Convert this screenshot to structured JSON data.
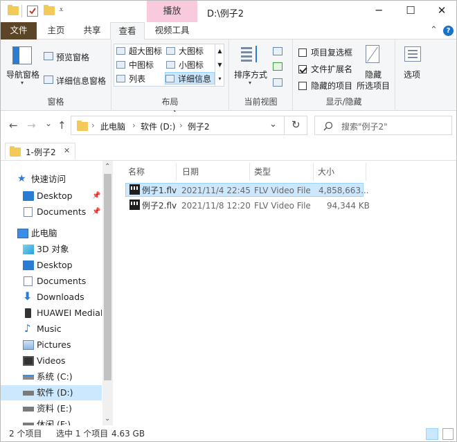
{
  "title": {
    "context_tab": "播放",
    "path": "D:\\例子2",
    "minimize": "─",
    "maximize": "☐",
    "close": "✕"
  },
  "ribbon_tabs": [
    {
      "label": "文件"
    },
    {
      "label": "主页"
    },
    {
      "label": "共享"
    },
    {
      "label": "查看"
    },
    {
      "label": "视频工具"
    }
  ],
  "ribbon": {
    "panes": {
      "nav_pane": "导航窗格",
      "preview_pane": "预览窗格",
      "details_pane": "详细信息窗格",
      "group_title": "窗格"
    },
    "layout": {
      "items": [
        "超大图标",
        "大图标",
        "中图标",
        "小图标",
        "列表",
        "详细信息"
      ],
      "group_title": "布局"
    },
    "current_view": {
      "sort": "排序方式",
      "group_title": "当前视图"
    },
    "show_hide": {
      "item_checkbox": "项目复选框",
      "extensions": "文件扩展名",
      "hidden_items": "隐藏的项目",
      "hide_selected_line1": "隐藏",
      "hide_selected_line2": "所选项目",
      "group_title": "显示/隐藏"
    },
    "options": "选项"
  },
  "address": {
    "back": "←",
    "forward": "→",
    "recent": "⌄",
    "up": "↑",
    "crumbs": [
      "此电脑",
      "软件 (D:)",
      "例子2"
    ],
    "sep": "›",
    "dropdown": "⌄",
    "refresh": "↻",
    "search_placeholder": "搜索\"例子2\""
  },
  "doc_tab": {
    "label": "1-例子2",
    "close": "✕"
  },
  "nav": {
    "quick_access": "快速访问",
    "items": [
      {
        "label": "Desktop"
      },
      {
        "label": "Documents"
      },
      {
        "label": "此电脑"
      },
      {
        "label": "3D 对象"
      },
      {
        "label": "Desktop"
      },
      {
        "label": "Documents"
      },
      {
        "label": "Downloads"
      },
      {
        "label": "HUAWEI MediaPad"
      },
      {
        "label": "Music"
      },
      {
        "label": "Pictures"
      },
      {
        "label": "Videos"
      },
      {
        "label": "系统 (C:)"
      },
      {
        "label": "软件 (D:)"
      },
      {
        "label": "资料 (E:)"
      },
      {
        "label": "休闲 (F:)"
      }
    ]
  },
  "columns": [
    "名称",
    "日期",
    "类型",
    "大小"
  ],
  "files": [
    {
      "name": "例子1.flv",
      "date": "2021/11/4 22:45",
      "type": "FLV Video File",
      "size": "4,858,663..."
    },
    {
      "name": "例子2.flv",
      "date": "2021/11/8 12:20",
      "type": "FLV Video File",
      "size": "94,344 KB"
    }
  ],
  "status": {
    "count": "2 个项目",
    "selected": "选中 1 个项目",
    "size": "4.63 GB"
  },
  "colors": {
    "file_tab": "#5c4426",
    "context_tab": "#f9c9de",
    "selection": "#cce8ff"
  }
}
